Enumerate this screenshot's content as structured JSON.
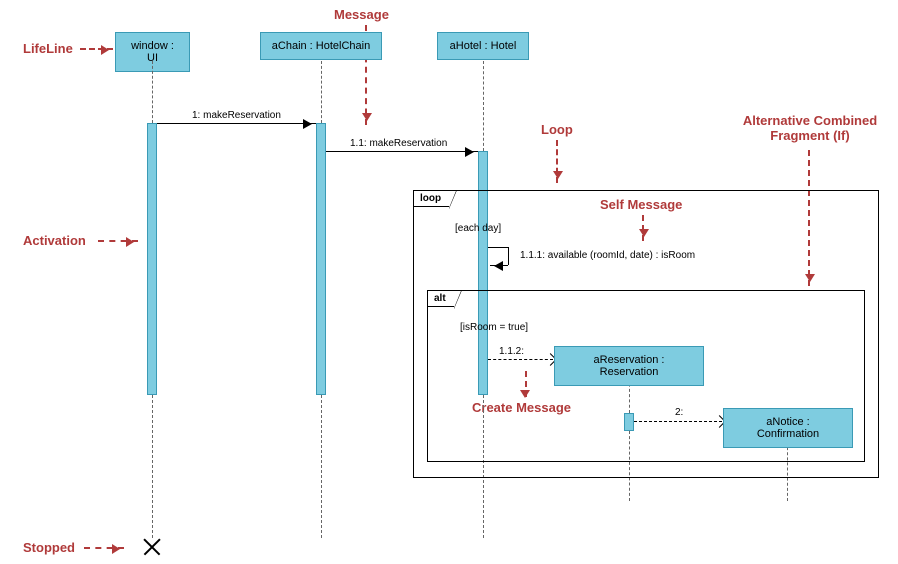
{
  "annotations": {
    "message": "Message",
    "lifeline": "LifeLine",
    "loop": "Loop",
    "alternative": "Alternative Combined Fragment (If)",
    "activation": "Activation",
    "self_message": "Self Message",
    "create_message": "Create Message",
    "stopped": "Stopped"
  },
  "lifelines": {
    "ui": "window : UI",
    "chain": "aChain : HotelChain",
    "hotel": "aHotel : Hotel",
    "reservation": "aReservation : Reservation",
    "notice": "aNotice : Confirmation"
  },
  "messages": {
    "m1": "1: makeReservation",
    "m11": "1.1: makeReservation",
    "m111": "1.1.1: available (roomId, date) : isRoom",
    "m112": "1.1.2:",
    "m2": "2:"
  },
  "fragments": {
    "loop_label": "loop",
    "loop_guard": "[each day]",
    "alt_label": "alt",
    "alt_guard": "[isRoom = true]"
  }
}
